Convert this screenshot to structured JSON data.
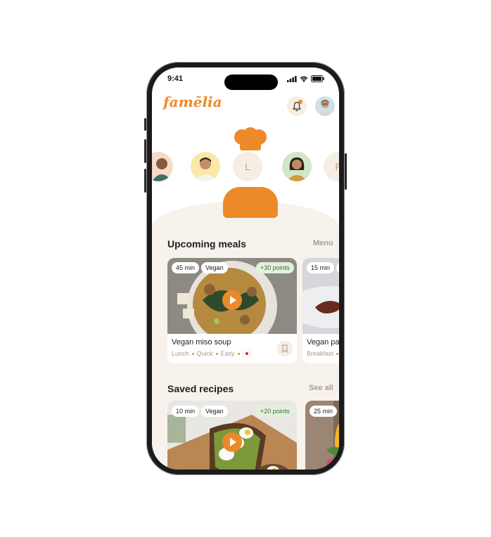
{
  "status_bar": {
    "time": "9:41"
  },
  "header": {
    "logo": "famēlia"
  },
  "family": {
    "letter_center": "L",
    "letter_right": "P"
  },
  "colors": {
    "accent": "#ec8a2a",
    "cream": "#f8f2ec",
    "points_bg": "#e3f1dc"
  },
  "upcoming": {
    "title": "Upcoming meals",
    "link": "Menu",
    "cards": [
      {
        "time": "45 min",
        "tag": "Vegan",
        "points": "+30 points",
        "title": "Vegan miso soup",
        "meta": [
          "Lunch",
          "Quick",
          "Easy"
        ]
      },
      {
        "time": "15 min",
        "tag": "D",
        "title": "Vegan panc",
        "meta": [
          "Breakfast",
          "F"
        ]
      }
    ]
  },
  "saved": {
    "title": "Saved recipes",
    "link": "See all",
    "cards": [
      {
        "time": "10 min",
        "tag": "Vegan",
        "points": "+20 points"
      },
      {
        "time": "25 min",
        "tag": "H"
      }
    ]
  }
}
